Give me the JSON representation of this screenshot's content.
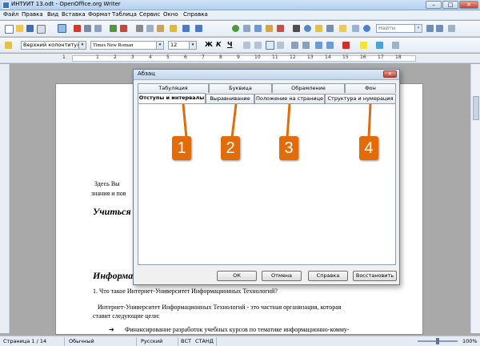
{
  "window": {
    "title": "ИНТУИТ 13.odt - OpenOffice.org Writer",
    "min": "–",
    "max": "□",
    "close": "✕"
  },
  "menu": [
    "Файл",
    "Правка",
    "Вид",
    "Вставка",
    "Формат",
    "Таблица",
    "Сервис",
    "Окно",
    "Справка"
  ],
  "toolbar": {
    "search_placeholder": "Найти",
    "paragraph_style": "Верхний колонтитул",
    "font_name": "Times New Roman",
    "font_size": "12",
    "bold": "Ж",
    "italic": "К",
    "underline": "Ч",
    "dropdown_arrow": "▾"
  },
  "ruler": {
    "numbers": [
      "1",
      "1",
      "2",
      "3",
      "4",
      "5",
      "6",
      "7",
      "8",
      "9",
      "10",
      "11",
      "12",
      "13",
      "14",
      "15",
      "16",
      "17",
      "18"
    ]
  },
  "document": {
    "intro_1": "Здесь Вы",
    "intro_2": "знания и пов",
    "heading_1": "Учиться",
    "heading_2": "Информа",
    "question": "1.  Что такое Интернет-Университет Информационных Технологий?",
    "para_1": "Интернет-Университет Информационных Технологий - это частная организация, которая",
    "para_2": "ставит следующие цели:",
    "bullet_1": "Финансирование разработок учебных курсов по тематике информационно-комму-",
    "bullet_arrow": "➔"
  },
  "dialog": {
    "title": "Абзац",
    "tabs_row1": [
      "Табуляция",
      "Буквица",
      "Обрамление",
      "Фон"
    ],
    "tabs_row2": [
      "Отступы и интервалы",
      "Выравнивание",
      "Положение на странице",
      "Структура и нумерация"
    ],
    "buttons": {
      "ok": "ОК",
      "cancel": "Отмена",
      "help": "Справка",
      "reset": "Восстановить"
    },
    "close": "✕"
  },
  "callouts": [
    "1",
    "2",
    "3",
    "4"
  ],
  "statusbar": {
    "page": "Страница  1 / 14",
    "style": "Обычный",
    "language": "Русский",
    "insert_mode": "ВСТ",
    "selection_mode": "СТАНД",
    "zoom": "100%"
  },
  "colors": {
    "callout": "#e36c0a",
    "titlebar": "#c3d6ec"
  }
}
